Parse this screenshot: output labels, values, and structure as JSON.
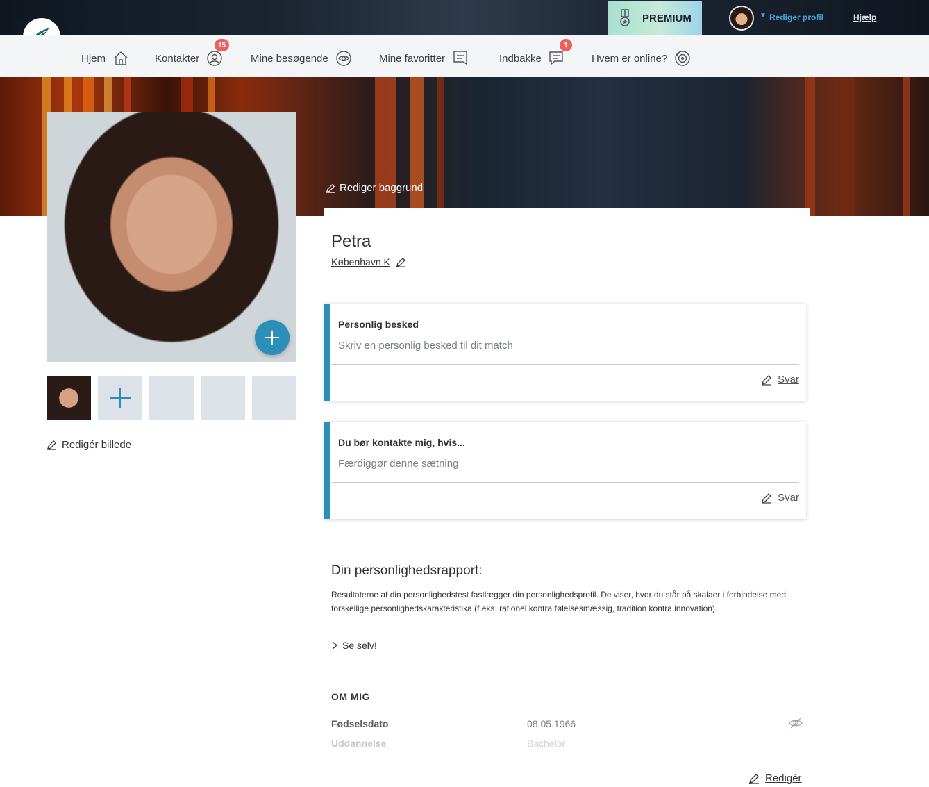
{
  "topbar": {
    "premium_label": "PREMIUM",
    "edit_profile_label": "Rediger profil",
    "help_label": "Hjælp"
  },
  "nav": {
    "items": [
      {
        "label": "Hjem",
        "icon": "home-icon"
      },
      {
        "label": "Kontakter",
        "icon": "contacts-icon",
        "badge": "15"
      },
      {
        "label": "Mine besøgende",
        "icon": "eye-icon"
      },
      {
        "label": "Mine favoritter",
        "icon": "bookmark-icon"
      },
      {
        "label": "Indbakke",
        "icon": "chat-icon",
        "badge": "1"
      },
      {
        "label": "Hvem er online?",
        "icon": "online-icon"
      }
    ]
  },
  "hero": {
    "edit_background_label": "Rediger baggrund"
  },
  "photos": {
    "edit_image_label": "Redigér billede"
  },
  "profile": {
    "name": "Petra",
    "city": "København K"
  },
  "cards": [
    {
      "title": "Personlig besked",
      "hint": "Skriv en personlig besked til dit match",
      "reply_label": "Svar"
    },
    {
      "title": "Du bør kontakte mig, hvis...",
      "hint": "Færdiggør denne sætning",
      "reply_label": "Svar"
    }
  ],
  "report": {
    "title": "Din personlighedsrapport:",
    "text": "Resultaterne af din personlighedstest fastlægger din personlighedsprofil. De viser, hvor du står på skalaer i forbindelse med forskellige personlighedskarakteristika (f.eks. rationel kontra følelsesmæssig, tradition kontra innovation).",
    "see_self_label": "Se selv!"
  },
  "about": {
    "title": "OM MIG",
    "rows": [
      {
        "label": "Fødselsdato",
        "value": "08.05.1966"
      },
      {
        "label": "Uddannelse",
        "value": "Bachelor"
      }
    ],
    "edit_label": "Redigér"
  },
  "colors": {
    "accent": "#2b8fb8",
    "badge": "#f05d5a",
    "link_blue": "#46a2d8"
  }
}
